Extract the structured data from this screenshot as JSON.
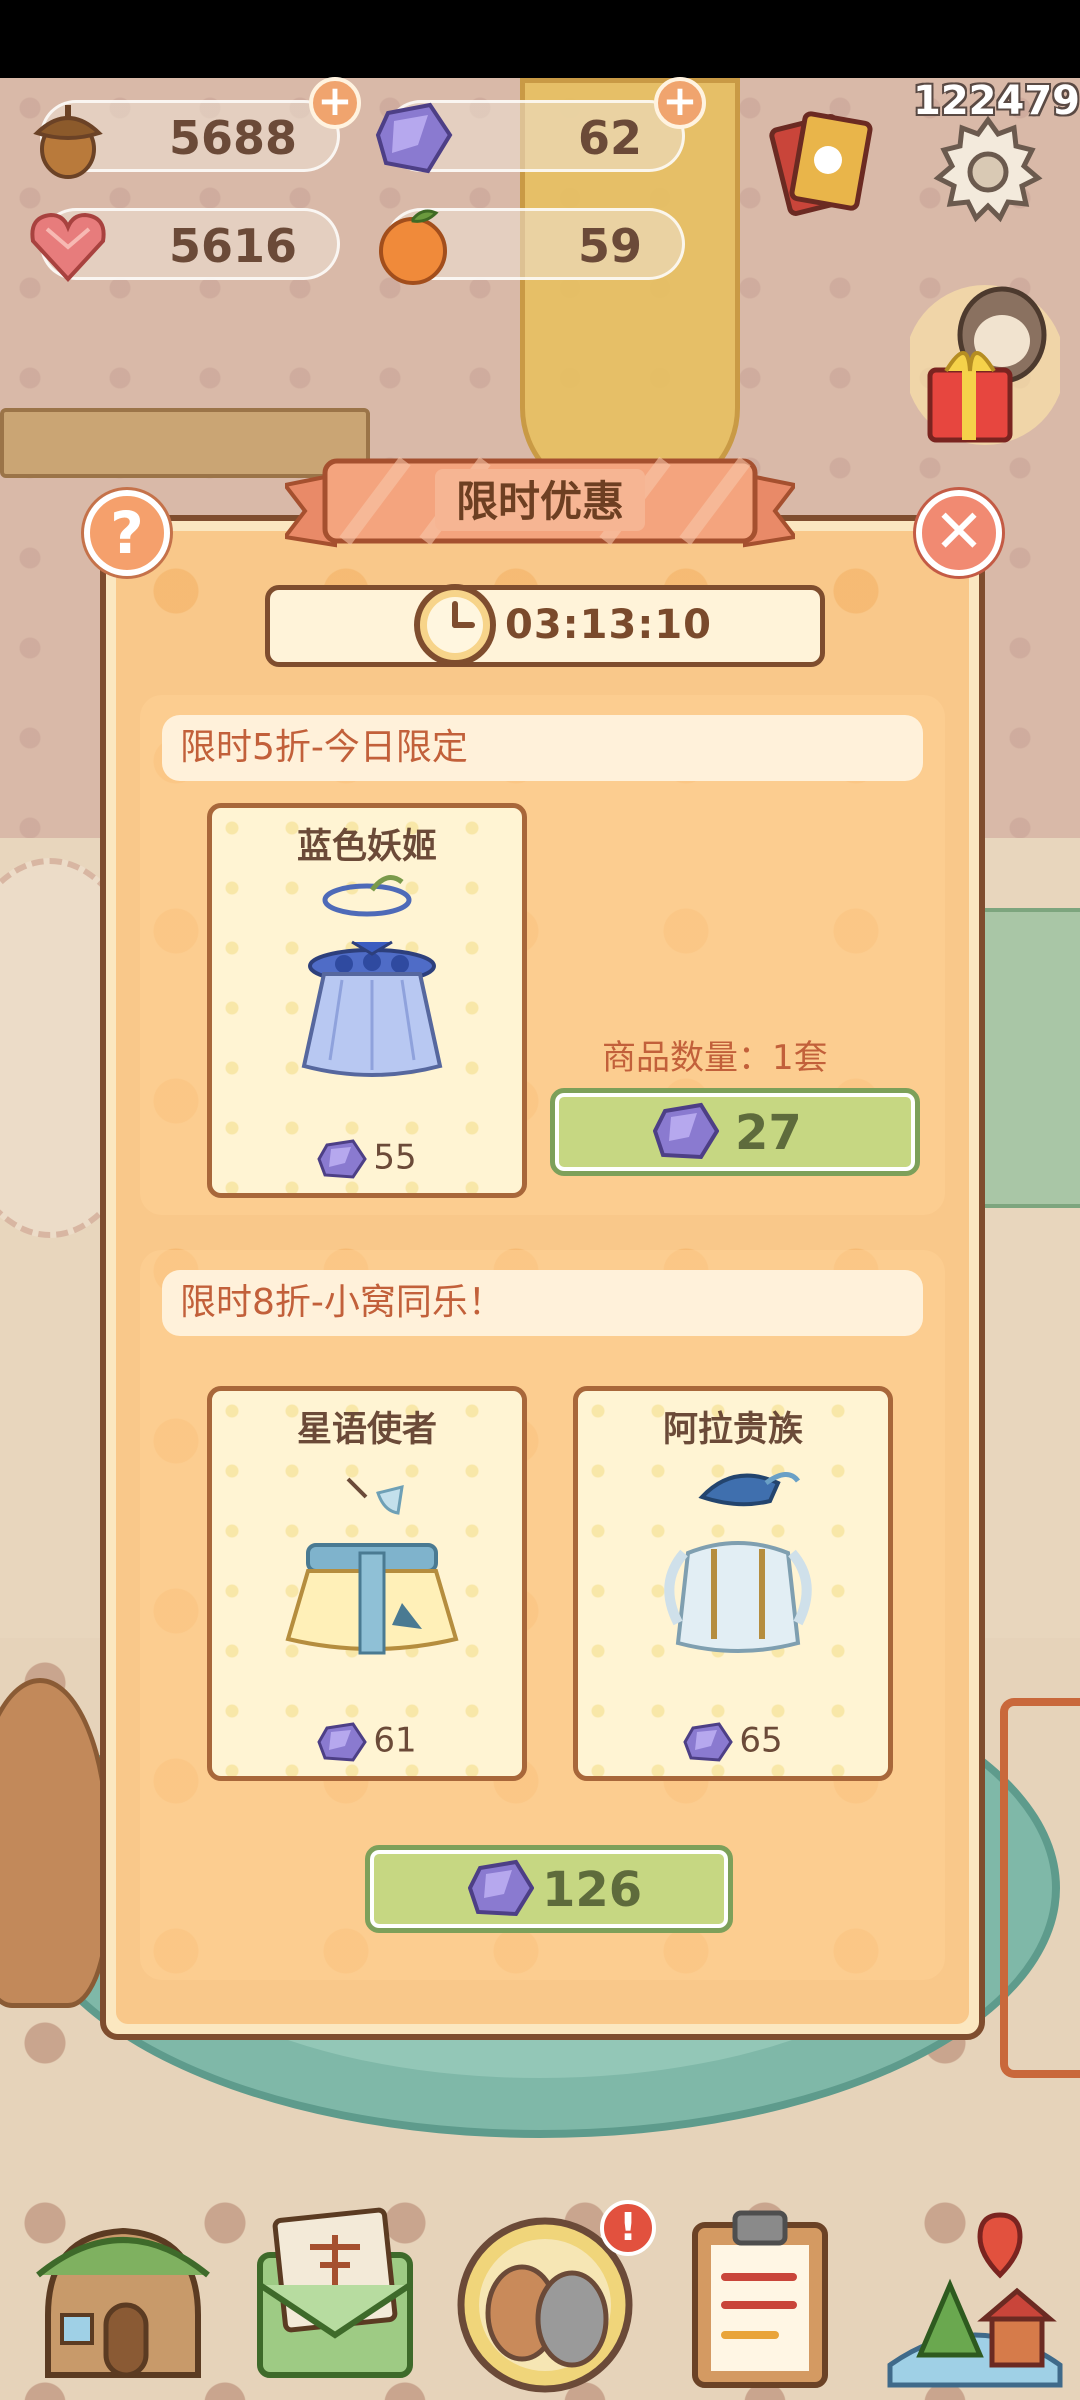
{
  "status_bar": {},
  "player": {
    "id": "122479"
  },
  "resources": {
    "acorns": {
      "value": "5688",
      "icon": "acorn-icon"
    },
    "gems": {
      "value": "62",
      "icon": "purple-gem-icon"
    },
    "hearts": {
      "value": "5616",
      "icon": "heart-gem-icon"
    },
    "oranges": {
      "value": "59",
      "icon": "orange-icon"
    }
  },
  "modal": {
    "title": "限时优惠",
    "help_label": "?",
    "close_label": "✕",
    "timer": "03:13:10",
    "section1": {
      "label": "限时5折-今日限定",
      "item": {
        "name": "蓝色妖姬",
        "price": "55"
      },
      "quantity_label": "商品数量：1套",
      "buy_price": "27"
    },
    "section2": {
      "label": "限时8折-小窝同乐！",
      "items": [
        {
          "name": "星语使者",
          "price": "61"
        },
        {
          "name": "阿拉贵族",
          "price": "65"
        }
      ],
      "buy_price": "126"
    }
  },
  "bottom_nav": {
    "items": [
      {
        "icon": "house-icon"
      },
      {
        "icon": "mail-icon"
      },
      {
        "icon": "friends-icon"
      },
      {
        "icon": "clipboard-icon"
      },
      {
        "icon": "map-icon"
      }
    ],
    "badge": "!"
  },
  "colors": {
    "modal_bg": "#f9c88a",
    "border": "#7f4d2e",
    "buy_button": "#c6d782",
    "label_text": "#c2603a"
  }
}
